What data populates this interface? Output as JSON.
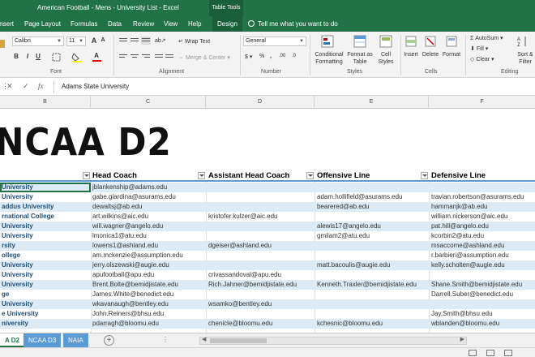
{
  "window": {
    "title": "American Football - Mens - University List  -  Excel",
    "context_tab": "Table Tools"
  },
  "ribbon_tabs": [
    "Insert",
    "Page Layout",
    "Formulas",
    "Data",
    "Review",
    "View",
    "Help",
    "Design"
  ],
  "tell_me": "Tell me what you want to do",
  "ribbon": {
    "font_name": "Calibri",
    "font_size": "11",
    "wrap_text": "Wrap Text",
    "merge_center": "Merge & Center",
    "number_format": "General",
    "conditional_formatting": "Conditional Formatting",
    "format_as_table": "Format as Table",
    "cell_styles": "Cell Styles",
    "insert": "Insert",
    "delete": "Delete",
    "format": "Format",
    "autosum": "AutoSum",
    "fill": "Fill",
    "clear": "Clear",
    "sort_filter": "Sort & Filter",
    "groups": {
      "font": "Font",
      "alignment": "Alignment",
      "number": "Number",
      "styles": "Styles",
      "cells": "Cells",
      "editing": "Editing"
    }
  },
  "formula_bar": {
    "value": "Adams State University"
  },
  "columns": [
    "B",
    "C",
    "D",
    "E",
    "F"
  ],
  "sheet": {
    "banner": "NCAA D2",
    "headers": {
      "school": "",
      "head_coach": "Head Coach",
      "assistant_head_coach": "Assistant Head Coach",
      "offensive_line": "Offensive Line",
      "defensive_line": "Defensive Line"
    },
    "rows": [
      {
        "school": "University",
        "head": "jblankenship@adams.edu",
        "asst": "",
        "ol": "",
        "dl": ""
      },
      {
        "school": "University",
        "head": "gabe.giardina@asurams.edu",
        "asst": "",
        "ol": "adam.hollifield@asurams.edu",
        "dl": "travian.robertson@asurams.edu"
      },
      {
        "school": "addus University",
        "head": "dewaltsj@ab.edu",
        "asst": "",
        "ol": "bearered@ab.edu",
        "dl": "hammanjk@ab.edu"
      },
      {
        "school": "rnational College",
        "head": "art.wilkins@aic.edu",
        "asst": "kristofer.kulzer@aic.edu",
        "ol": "",
        "dl": "william.nickerson@aic.edu"
      },
      {
        "school": "University",
        "head": "will.wagner@angelo.edu",
        "asst": "",
        "ol": "alewis17@angelo.edu",
        "dl": "pat.hill@angelo.edu"
      },
      {
        "school": "University",
        "head": "lmonica1@atu.edu",
        "asst": "",
        "ol": "gmilam2@atu.edu",
        "dl": "kcorbin2@atu.edu"
      },
      {
        "school": "rsity",
        "head": "lowens1@ashland.edu",
        "asst": "dgeiser@ashland.edu",
        "ol": "",
        "dl": "msaccome@ashland.edu"
      },
      {
        "school": "ollege",
        "head": "am.mckenzie@assumption.edu",
        "asst": "",
        "ol": "",
        "dl": "r.barbieri@assumption.edu"
      },
      {
        "school": "University",
        "head": "jerry.olszewski@augie.edu",
        "asst": "",
        "ol": "matt.bacoulis@augie.edu",
        "dl": "kelly.scholten@augie.edu"
      },
      {
        "school": "University",
        "head": "apufootball@apu.edu",
        "asst": "crivassandoval@apu.edu",
        "ol": "",
        "dl": ""
      },
      {
        "school": "University",
        "head": "Brent.Bolte@bemidjistate.edu",
        "asst": "Rich.Jahner@bemidjistate.edu",
        "ol": "Kenneth.Traxler@bemidjistate.edu",
        "dl": "Shane.Smith@bemidjistate.edu"
      },
      {
        "school": "ge",
        "head": "James.White@benedict.edu",
        "asst": "",
        "ol": "",
        "dl": "Darrell.Suber@benedict.edu"
      },
      {
        "school": "University",
        "head": "wkavanaugh@bentley.edu",
        "asst": "wsamko@bentley.edu",
        "ol": "",
        "dl": ""
      },
      {
        "school": "e University",
        "head": "John.Reiners@bhsu.edu",
        "asst": "",
        "ol": "",
        "dl": "Jay.Smith@bhsu.edu"
      },
      {
        "school": "niversity",
        "head": "pdarragh@bloomu.edu",
        "asst": "chenicle@bloomu.edu",
        "ol": "kchesnic@bloomu.edu",
        "dl": "wblanden@bloomu.edu"
      }
    ]
  },
  "sheet_tabs": [
    {
      "label": "A D2",
      "active": true
    },
    {
      "label": "NCAA D3",
      "active": false
    },
    {
      "label": "NAIA",
      "active": false
    }
  ],
  "colors": {
    "excel_green": "#217346",
    "table_band": "#ddebf7",
    "table_header_border": "#5b9bd5",
    "school_text": "#1f4e79"
  }
}
